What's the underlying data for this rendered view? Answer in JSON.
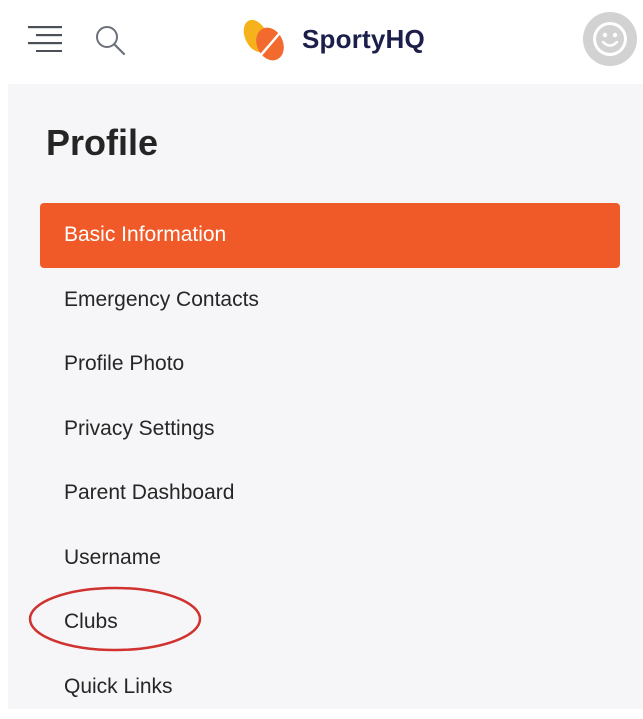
{
  "header": {
    "menu_icon": "hamburger-menu-icon",
    "search_icon": "search-icon",
    "logo_text": "SportyHQ",
    "avatar_icon": "smiley-avatar-icon"
  },
  "colors": {
    "accent": "#f05a28",
    "logo_orange": "#f26a2e",
    "logo_yellow": "#f6b21a",
    "brand_text": "#1b1f4a",
    "annotation_red": "#d0322f"
  },
  "profile": {
    "title": "Profile",
    "menu": [
      {
        "label": "Basic Information",
        "active": true
      },
      {
        "label": "Emergency Contacts",
        "active": false
      },
      {
        "label": "Profile Photo",
        "active": false
      },
      {
        "label": "Privacy Settings",
        "active": false
      },
      {
        "label": "Parent Dashboard",
        "active": false
      },
      {
        "label": "Username",
        "active": false
      },
      {
        "label": "Clubs",
        "active": false,
        "highlighted": true
      },
      {
        "label": "Quick Links",
        "active": false
      }
    ]
  }
}
